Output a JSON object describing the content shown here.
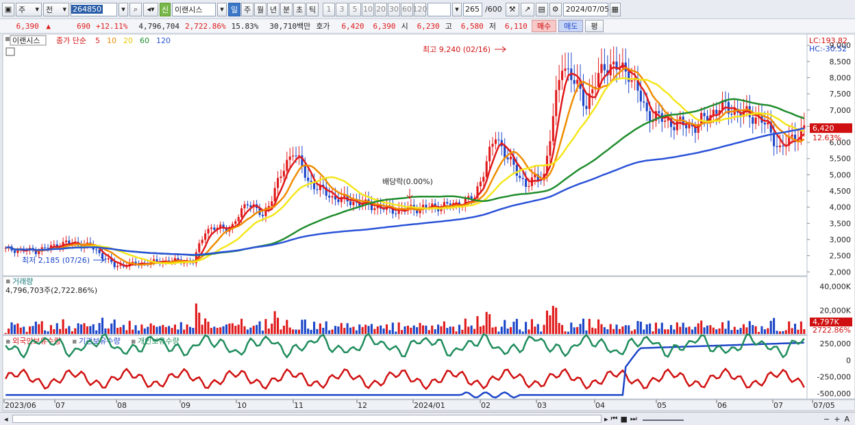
{
  "toolbar": {
    "market": "주",
    "scope": "전",
    "code": "264850",
    "badge": "신",
    "name": "이랜시스",
    "periods": [
      "일",
      "주",
      "월",
      "년",
      "분",
      "초",
      "틱"
    ],
    "minutes": [
      "1",
      "3",
      "5",
      "10",
      "20",
      "30",
      "60",
      "120"
    ],
    "count": "265",
    "total": "/600",
    "date": "2024/07/05"
  },
  "quote": {
    "price": "6,390",
    "change": "690",
    "rate": "+12.11%",
    "volume": "4,796,704",
    "vol_rate": "2,722.86%",
    "turnover": "15.83%",
    "amount": "30,710백만",
    "hoga_label": "호가",
    "hoga1": "6,420",
    "hoga2": "6,390",
    "open_label": "시",
    "open": "6,230",
    "high_label": "고",
    "high": "6,580",
    "low_label": "저",
    "low": "6,110",
    "buy": "매수",
    "sell": "매도",
    "eval": "평"
  },
  "price_panel": {
    "legend_name": "이랜시스",
    "legend_title": "종가 단순",
    "ma_periods": [
      "5",
      "10",
      "20",
      "60",
      "120"
    ],
    "lc": "LC:193.82",
    "hc": "HC:-30.52",
    "high_note": "최고 9,240 (02/16)",
    "low_note": "최저 2,185 (07/26)",
    "dividend_note": "배당락(0.00%)",
    "price_tag": "6,420",
    "pct_tag": "12.63%",
    "y_labels": [
      "9,000",
      "8,500",
      "8,000",
      "7,500",
      "7,000",
      "6,500",
      "6,000",
      "5,500",
      "5,000",
      "4,500",
      "4,000",
      "3,500",
      "3,000",
      "2,500",
      "2,000"
    ]
  },
  "volume_panel": {
    "title": "거래량",
    "value": "4,796,703주(2,722.86%)",
    "y_labels": [
      "40,000K",
      "20,000K"
    ],
    "tag": "4,797K",
    "tag2": "2722.86%"
  },
  "holdings_panel": {
    "series": [
      "외국인보유수량",
      "기관보유수량",
      "개인보유수량"
    ],
    "y_labels": [
      "250,000",
      "0",
      "-250,000",
      "-500,000"
    ]
  },
  "x_axis": [
    "2023/06",
    "07",
    "08",
    "09",
    "10",
    "11",
    "12",
    "2024/01",
    "02",
    "03",
    "04",
    "05",
    "06",
    "07",
    "07/05"
  ],
  "chart_data": {
    "type": "candlestick",
    "x": [
      "2023/06",
      "2023/07",
      "2023/08",
      "2023/09",
      "2023/10",
      "2023/11",
      "2023/12",
      "2024/01",
      "2024/02",
      "2024/03",
      "2024/04",
      "2024/05",
      "2024/06",
      "2024/07"
    ],
    "approx_close": [
      2700,
      2300,
      2400,
      3600,
      4300,
      4300,
      3900,
      4100,
      6500,
      7800,
      6800,
      7100,
      6700,
      6420
    ],
    "ylim": [
      1900,
      9300
    ],
    "colors": {
      "up": "#e0191b",
      "down": "#1b45c8",
      "ma5": "#e0191b",
      "ma10": "#f08c00",
      "ma20": "#f5e61a",
      "ma60": "#1f8c2c",
      "ma120": "#2a52d8"
    }
  }
}
